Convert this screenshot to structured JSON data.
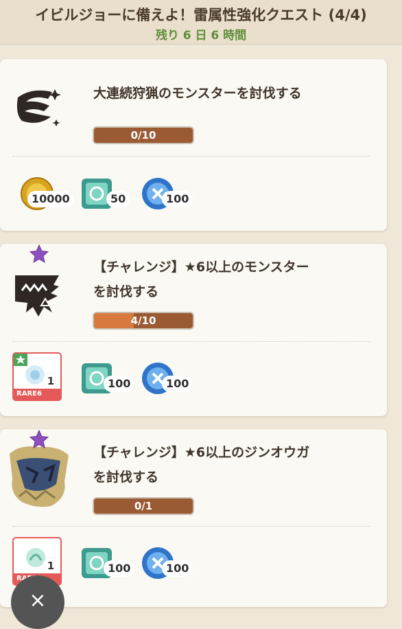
{
  "header": {
    "title": "イビルジョーに備えよ！雷属性強化クエスト (4/4)",
    "remaining": "残り 6 日 6 時間"
  },
  "quests": [
    {
      "icon": "consecutive-hunt-icon",
      "text_lines": [
        "大連続狩猟のモンスターを討伐する"
      ],
      "progress_label": "0/10",
      "progress_fraction": 0.0,
      "rewards": [
        {
          "icon": "gold-coin-icon",
          "qty": "10000"
        },
        {
          "icon": "green-gem-icon",
          "qty": "50"
        },
        {
          "icon": "blue-orb-icon",
          "qty": "100"
        }
      ]
    },
    {
      "icon": "monster-jaw-icon",
      "star": true,
      "text_lines": [
        "【チャレンジ】★6以上のモンスター",
        "を討伐する"
      ],
      "progress_label": "4/10",
      "progress_fraction": 0.4,
      "rewards": [
        {
          "icon": "rare-material-icon",
          "qty": "1",
          "rarity": "RARE6"
        },
        {
          "icon": "green-gem-icon",
          "qty": "100"
        },
        {
          "icon": "blue-orb-icon",
          "qty": "100"
        }
      ]
    },
    {
      "icon": "zinogre-portrait-icon",
      "star": true,
      "text_lines": [
        "【チャレンジ】★6以上のジンオウガ",
        "を討伐する"
      ],
      "progress_label": "0/1",
      "progress_fraction": 0.0,
      "rewards": [
        {
          "icon": "rare-material-icon",
          "qty": "1",
          "rarity": "RARE6"
        },
        {
          "icon": "green-gem-icon",
          "qty": "100"
        },
        {
          "icon": "blue-orb-icon",
          "qty": "100"
        }
      ]
    }
  ],
  "close_button": {
    "label": "×"
  },
  "colors": {
    "background": "#efe7d8",
    "card": "#fbf9f4",
    "progress_bar": "#9a5a34",
    "progress_fill": "#d87a3f",
    "rare_frame": "#e45a5a",
    "remaining_text": "#5f8f3a"
  }
}
